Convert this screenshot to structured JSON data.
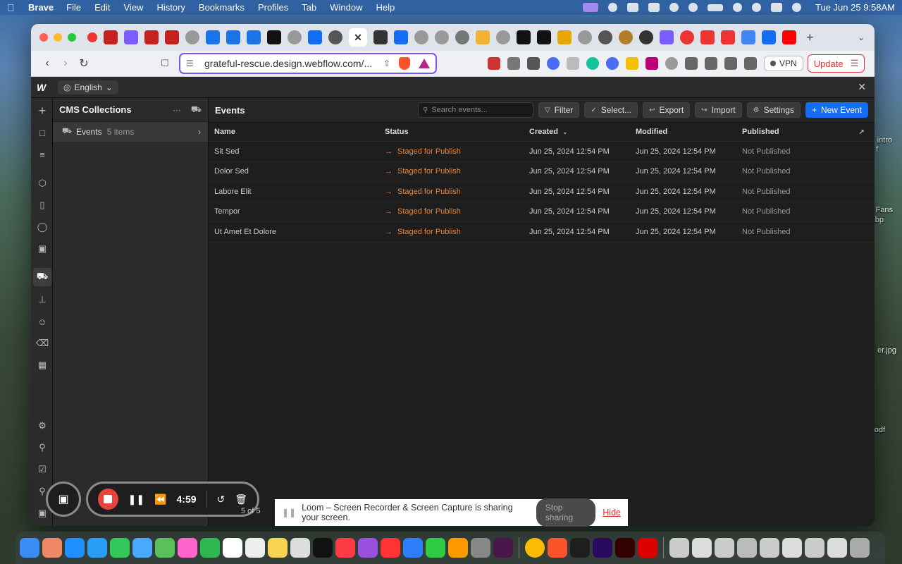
{
  "menubar": {
    "app_name": "Brave",
    "items": [
      "File",
      "Edit",
      "View",
      "History",
      "Bookmarks",
      "Profiles",
      "Tab",
      "Window",
      "Help"
    ],
    "clock": "Tue Jun 25  9:58AM"
  },
  "desktop_files": [
    "intro",
    "f",
    "Fans",
    "bp",
    "er.jpg",
    "odf"
  ],
  "browser": {
    "url": "grateful-rescue.design.webflow.com/...",
    "vpn_label": "VPN",
    "update_label": "Update",
    "shields_badge": "6"
  },
  "webflow": {
    "language": "English",
    "sidebar": {
      "title": "CMS Collections",
      "collection": {
        "name": "Events",
        "count": "5 items"
      }
    },
    "main": {
      "title": "Events",
      "search_placeholder": "Search events...",
      "buttons": {
        "filter": "Filter",
        "select": "Select...",
        "export": "Export",
        "import": "Import",
        "settings": "Settings",
        "new": "New Event"
      },
      "columns": [
        "Name",
        "Status",
        "Created",
        "Modified",
        "Published"
      ],
      "rows": [
        {
          "name": "Sit Sed",
          "status": "Staged for Publish",
          "created": "Jun 25, 2024 12:54 PM",
          "modified": "Jun 25, 2024 12:54 PM",
          "published": "Not Published"
        },
        {
          "name": "Dolor Sed",
          "status": "Staged for Publish",
          "created": "Jun 25, 2024 12:54 PM",
          "modified": "Jun 25, 2024 12:54 PM",
          "published": "Not Published"
        },
        {
          "name": "Labore Elit",
          "status": "Staged for Publish",
          "created": "Jun 25, 2024 12:54 PM",
          "modified": "Jun 25, 2024 12:54 PM",
          "published": "Not Published"
        },
        {
          "name": "Tempor",
          "status": "Staged for Publish",
          "created": "Jun 25, 2024 12:54 PM",
          "modified": "Jun 25, 2024 12:54 PM",
          "published": "Not Published"
        },
        {
          "name": "Ut Amet Et Dolore",
          "status": "Staged for Publish",
          "created": "Jun 25, 2024 12:54 PM",
          "modified": "Jun 25, 2024 12:54 PM",
          "published": "Not Published"
        }
      ],
      "pagination": "5 of 5"
    }
  },
  "loom": {
    "timer": "4:59",
    "banner_text": "Loom – Screen Recorder & Screen Capture is sharing your screen.",
    "stop_sharing": "Stop sharing",
    "hide": "Hide"
  },
  "colors": {
    "accent_blue": "#146ef5",
    "status_orange": "#e8873a",
    "url_border": "#7b54f5",
    "loom_red": "#e8453c"
  }
}
